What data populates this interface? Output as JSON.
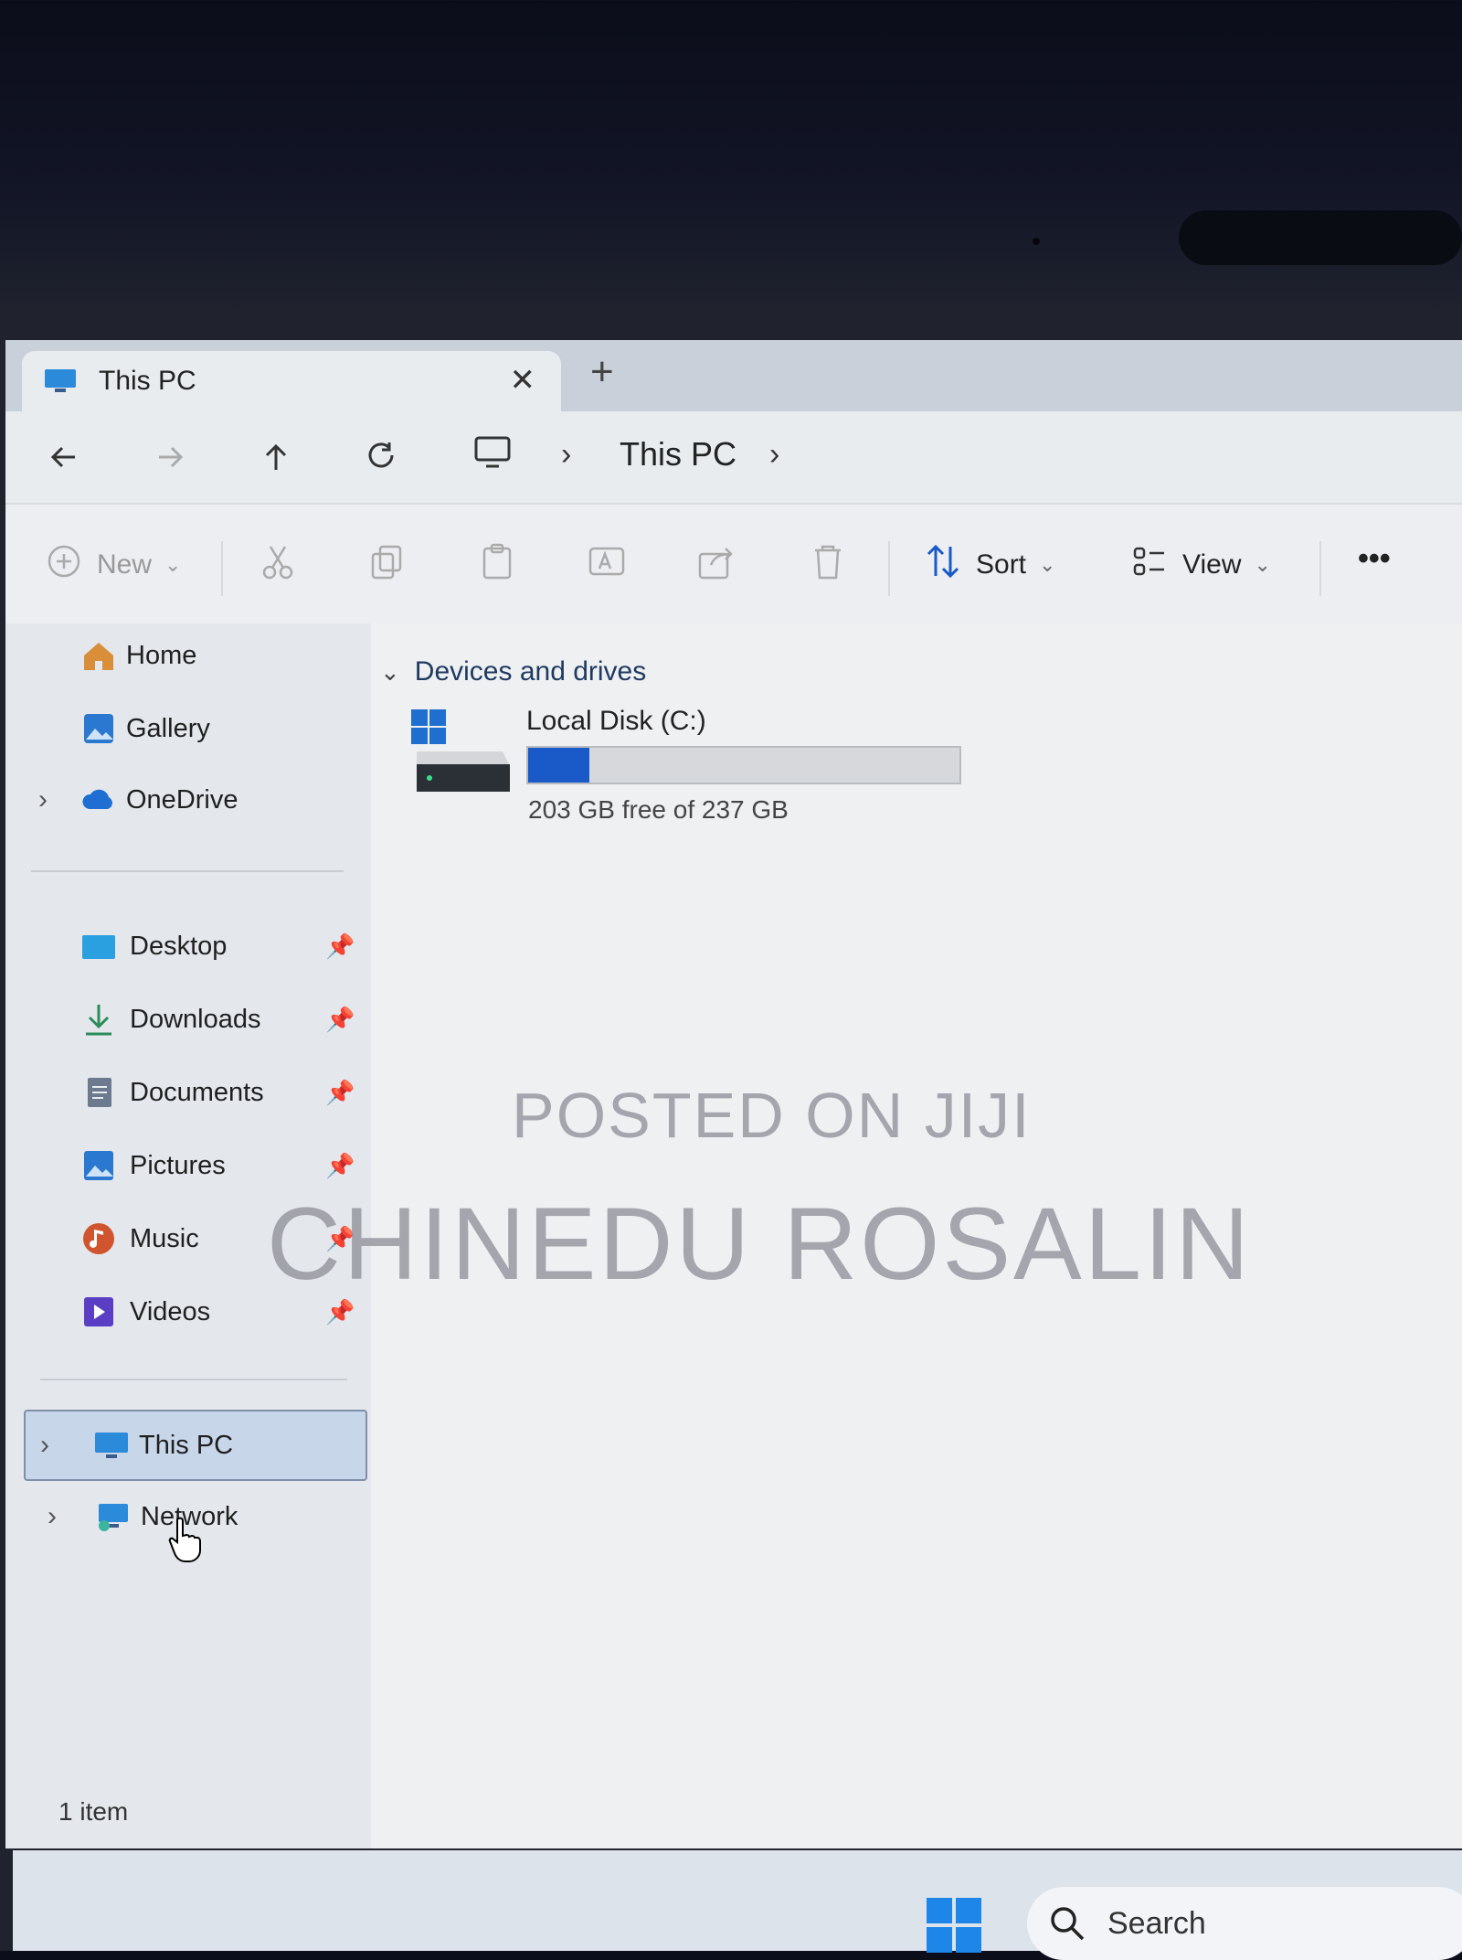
{
  "window": {
    "tab_title": "This PC",
    "address": {
      "location": "This PC"
    }
  },
  "toolbar": {
    "new_label": "New",
    "sort_label": "Sort",
    "view_label": "View",
    "more_label": "•••"
  },
  "sidebar": {
    "items": [
      {
        "label": "Home"
      },
      {
        "label": "Gallery"
      },
      {
        "label": "OneDrive"
      }
    ],
    "quick_access": [
      {
        "label": "Desktop"
      },
      {
        "label": "Downloads"
      },
      {
        "label": "Documents"
      },
      {
        "label": "Pictures"
      },
      {
        "label": "Music"
      },
      {
        "label": "Videos"
      }
    ],
    "locations": [
      {
        "label": "This PC"
      },
      {
        "label": "Network"
      }
    ]
  },
  "content": {
    "group_title": "Devices and drives",
    "drive": {
      "name": "Local Disk (C:)",
      "free_text": "203 GB free of 237 GB",
      "used_fraction": 0.143
    }
  },
  "status": {
    "item_count": "1 item"
  },
  "watermark": {
    "line1": "POSTED ON JIJI",
    "line2": "CHINEDU ROSALIN"
  },
  "taskbar": {
    "search_placeholder": "Search"
  },
  "colors": {
    "accent": "#1a59c8",
    "selected_bg": "#c8d6ea"
  }
}
